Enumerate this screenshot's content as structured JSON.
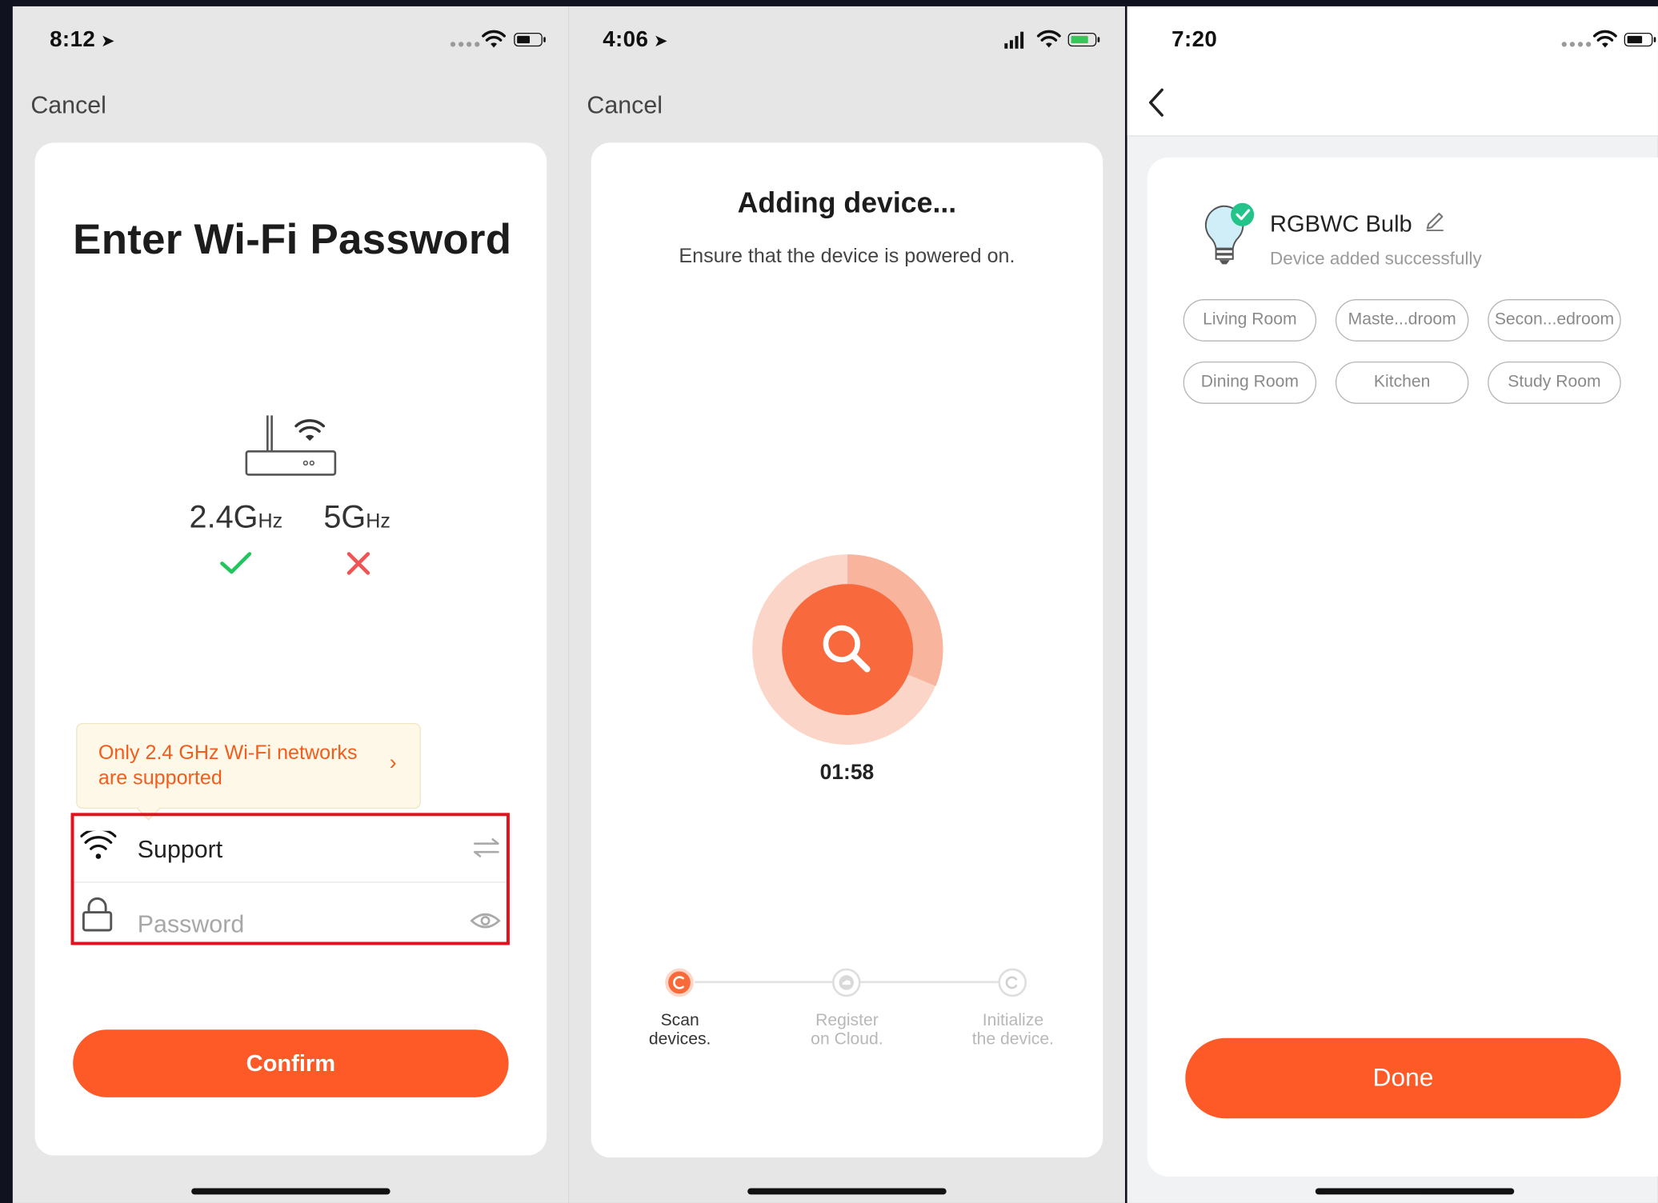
{
  "screen1": {
    "time": "8:12",
    "cancel": "Cancel",
    "title": "Enter Wi-Fi Password",
    "band_24": "2.4G",
    "band_5": "5G",
    "band_unit": "Hz",
    "tip": "Only 2.4 GHz Wi-Fi networks are supported",
    "network_name": "Support",
    "password_placeholder": "Password",
    "confirm": "Confirm"
  },
  "screen2": {
    "time": "4:06",
    "cancel": "Cancel",
    "title": "Adding device...",
    "subtitle": "Ensure that the device is powered on.",
    "timer": "01:58",
    "steps": [
      {
        "line1": "Scan",
        "line2": "devices."
      },
      {
        "line1": "Register",
        "line2": "on Cloud."
      },
      {
        "line1": "Initialize",
        "line2": "the device."
      }
    ]
  },
  "screen3": {
    "time": "7:20",
    "device_name": "RGBWC Bulb",
    "device_status": "Device added successfully",
    "rooms": [
      "Living Room",
      "Maste...droom",
      "Secon...edroom",
      "Dining Room",
      "Kitchen",
      "Study Room"
    ],
    "done": "Done"
  },
  "colors": {
    "accent": "#fd5a28",
    "highlight_box": "#e3101e",
    "tip_text": "#f25c1c",
    "success": "#22c55e",
    "error": "#f05454"
  }
}
